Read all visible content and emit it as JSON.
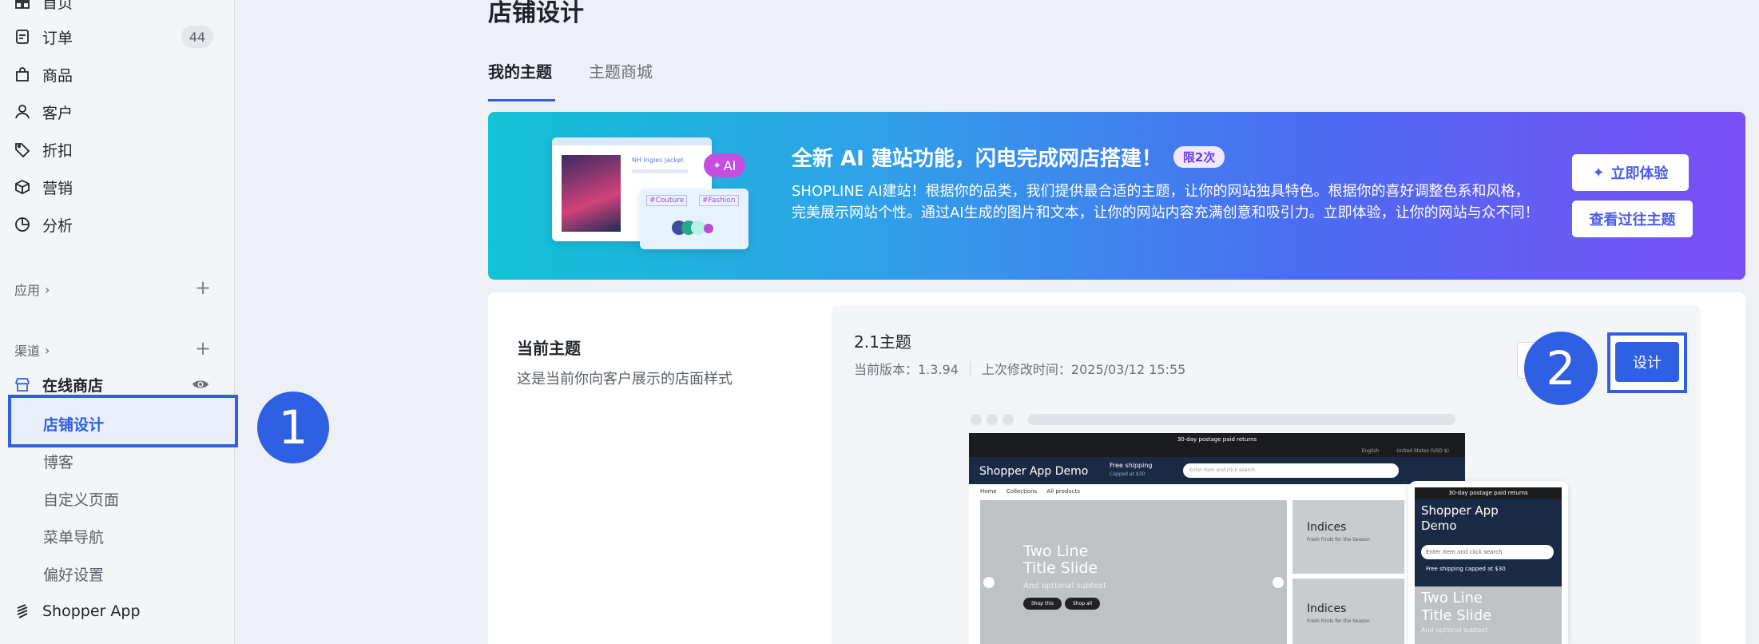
{
  "sidebar": {
    "items": [
      {
        "label": "首页",
        "icon": "home-icon"
      },
      {
        "label": "订单",
        "icon": "order-icon",
        "badge": "44"
      },
      {
        "label": "商品",
        "icon": "bag-icon"
      },
      {
        "label": "客户",
        "icon": "user-icon"
      },
      {
        "label": "折扣",
        "icon": "tag-icon"
      },
      {
        "label": "营销",
        "icon": "box-icon"
      },
      {
        "label": "分析",
        "icon": "pie-chart-icon"
      }
    ],
    "apps_section": "应用",
    "channels_section": "渠道",
    "online_store": "在线商店",
    "online_store_sub": [
      "店铺设计",
      "博客",
      "自定义页面",
      "菜单导航",
      "偏好设置"
    ],
    "shopper_app": "Shopper App"
  },
  "annotations": {
    "step1": "1",
    "step2": "2"
  },
  "page": {
    "title": "店铺设计",
    "tabs": [
      "我的主题",
      "主题商城"
    ]
  },
  "banner": {
    "title": "全新 AI 建站功能，闪电完成网店搭建！",
    "tag": "限2次",
    "description": "SHOPLINE AI建站！根据你的品类，我们提供最合适的主题，让你的网站独具特色。根据你的喜好调整色系和风格，完美展示网站个性。通过AI生成的图片和文本，让你的网站内容充满创意和吸引力。立即体验，让你的网站与众不同！",
    "try_button": "立即体验",
    "past_button": "查看过往主题",
    "illustration": {
      "ai_chip": "AI",
      "product_title": "NH Ingles jacket",
      "chip1": "#Couture",
      "chip2": "#Fashion"
    }
  },
  "current_theme": {
    "heading": "当前主题",
    "description": "这是当前你向客户展示的店面样式",
    "name": "2.1主题",
    "version": "当前版本：1.3.94",
    "modified": "上次修改时间：2025/03/12 15:55",
    "design_button": "设计"
  },
  "preview": {
    "announcement": "30-day postage paid returns",
    "topbar_right1": "English",
    "topbar_right2": "United States (USD $)",
    "store_name": "Shopper App Demo",
    "shipping_line1": "Free shipping",
    "shipping_line2": "Capped at $30",
    "search_placeholder": "Enter item and click search",
    "nav": [
      "Home",
      "Collections",
      "All products"
    ],
    "slide_title_line1": "Two Line",
    "slide_title_line2": "Title Slide",
    "slide_subtitle": "And optional subtext",
    "btn_shop_this": "Shop this",
    "btn_shop_all": "Shop all",
    "tile1_title": "Indices",
    "tile1_sub": "Fresh Finds for the Season",
    "tile2_title": "Indices",
    "tile2_sub": "Fresh Finds for the Season",
    "mobile": {
      "announcement": "30-day postage paid returns",
      "store_name_line1": "Shopper App",
      "store_name_line2": "Demo",
      "search_placeholder": "Enter item and click search",
      "shipping": "Free shipping capped at $30",
      "slide_line1": "Two Line",
      "slide_line2": "Title Slide",
      "slide_sub": "And optional subtext"
    }
  },
  "colors": {
    "accent": "#2f5fe3",
    "sidebar_bg": "#f4f5f7",
    "page_bg": "#edf0f4"
  }
}
